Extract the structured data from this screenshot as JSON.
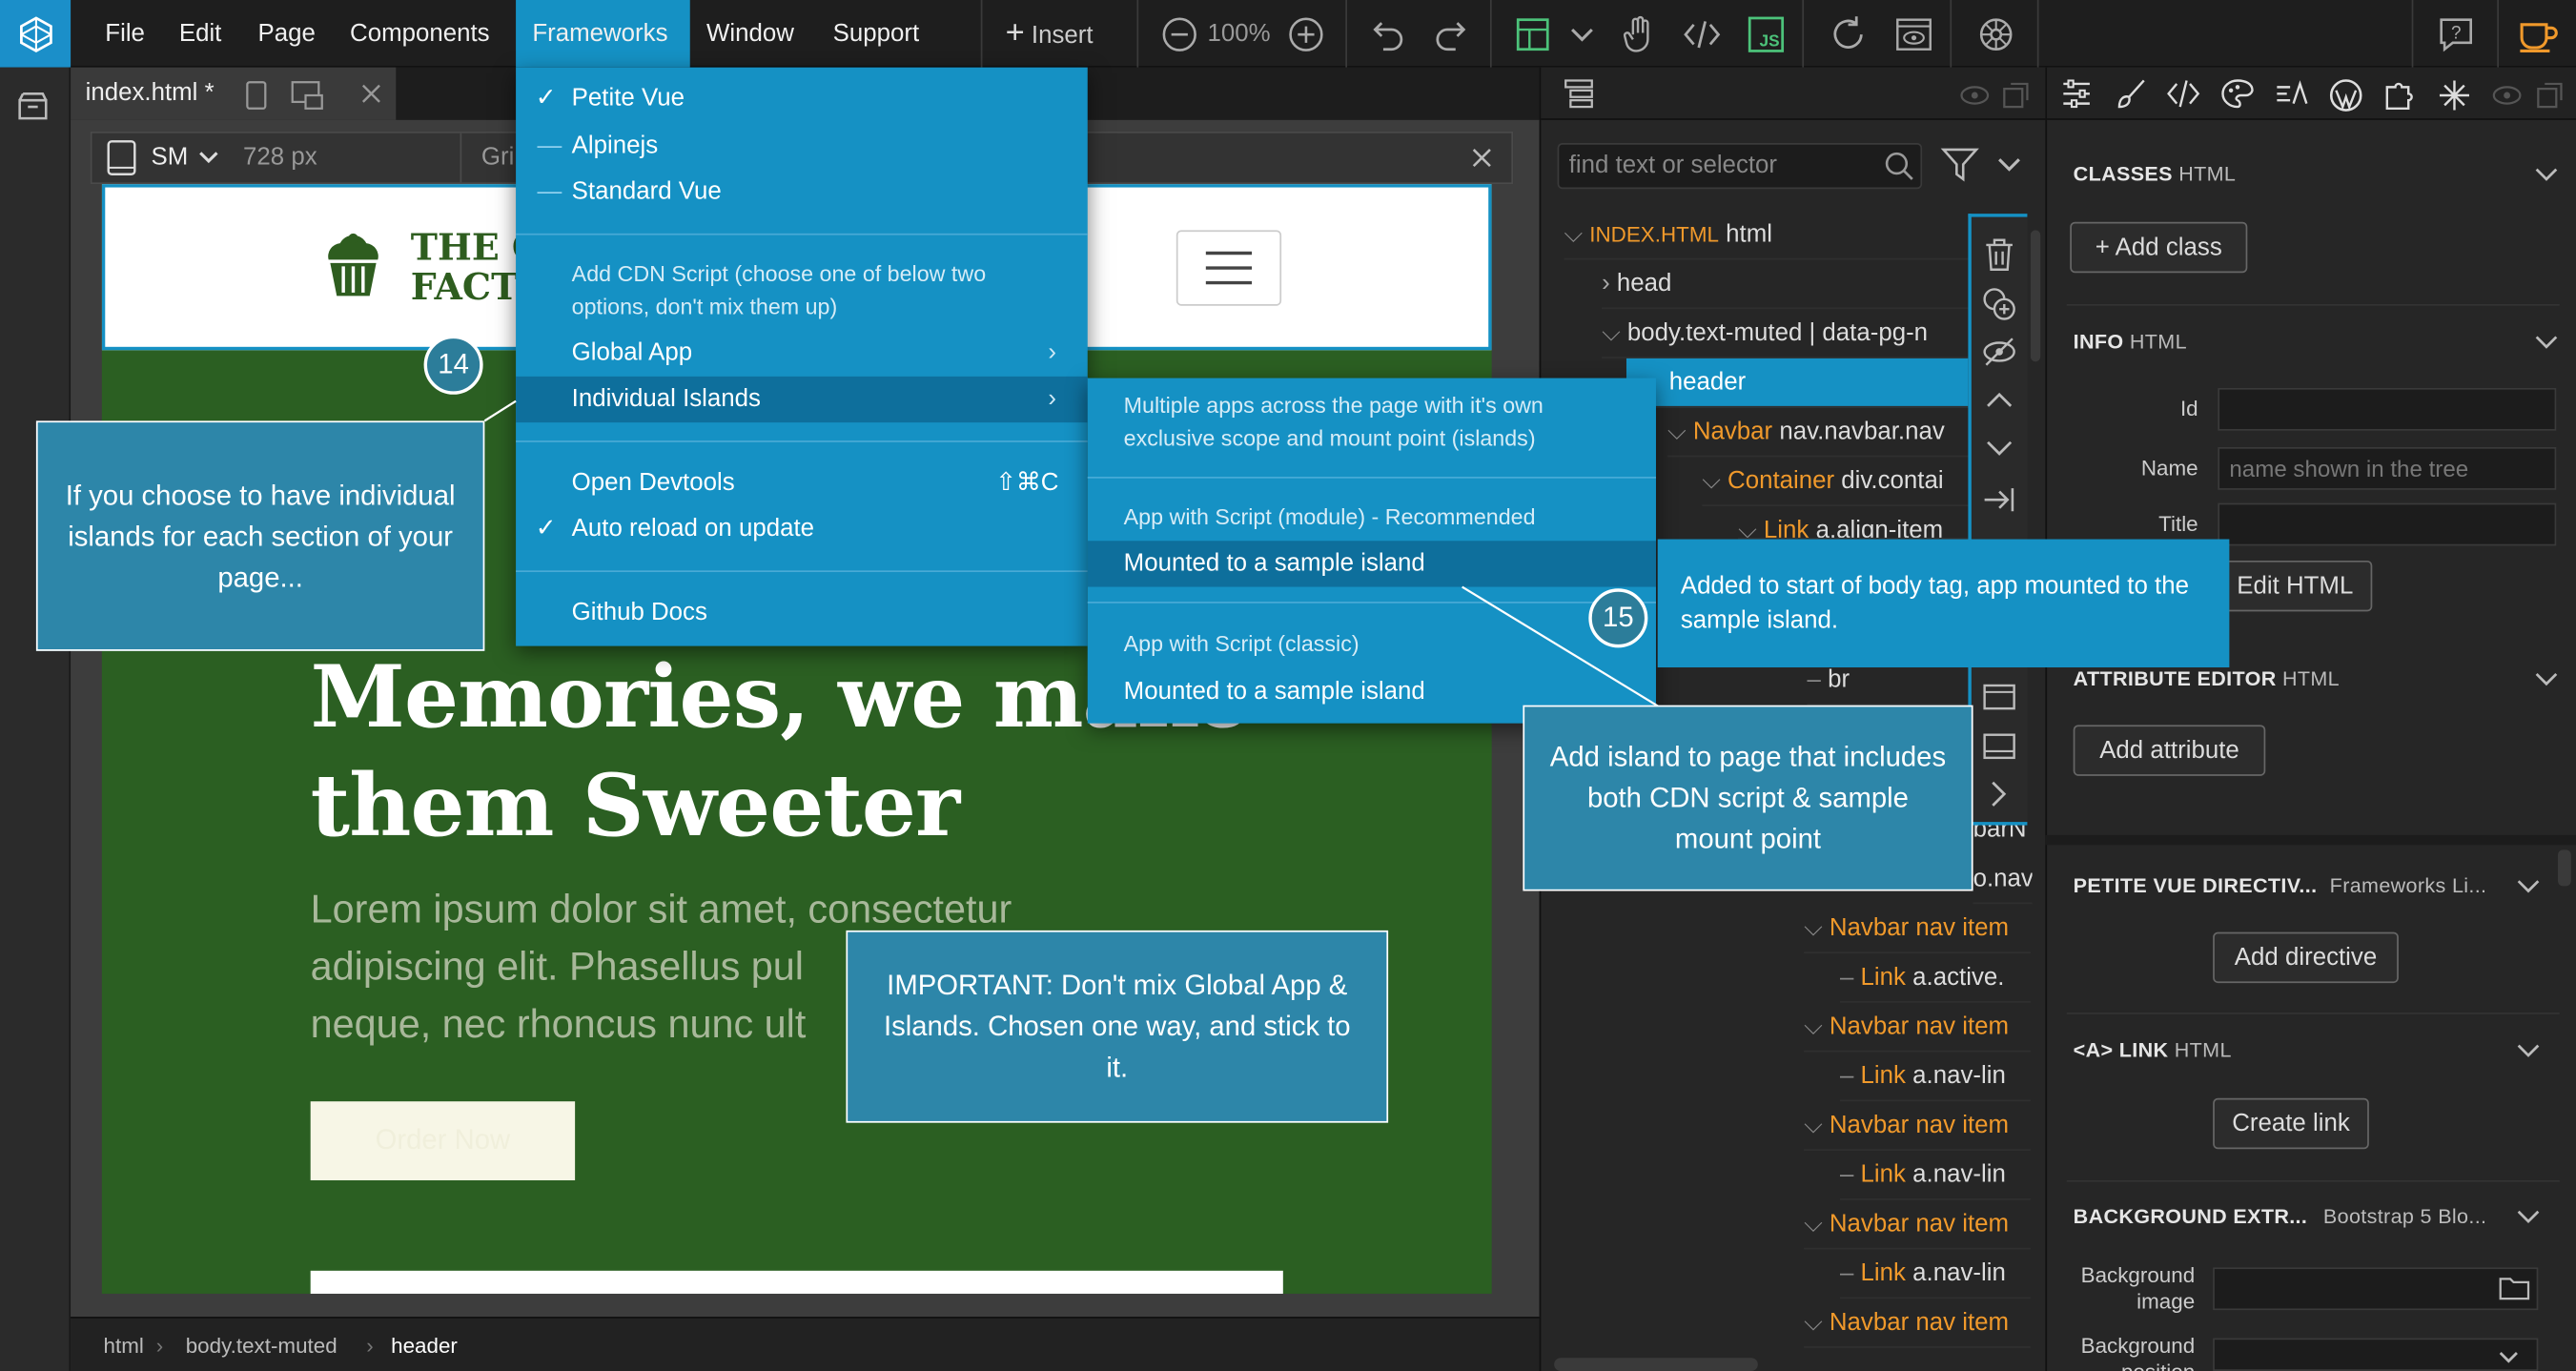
{
  "menubar": {
    "items": [
      "File",
      "Edit",
      "Page",
      "Components",
      "Frameworks",
      "Window",
      "Support"
    ],
    "insert_label": "Insert",
    "zoom": "100%"
  },
  "tab": {
    "filename": "index.html *"
  },
  "device": {
    "size": "SM",
    "width": "728 px",
    "grid_label": "Gri"
  },
  "site": {
    "brand_line1": "THE C",
    "brand_line2": "FACTO",
    "hero_line1": "Memories, we make",
    "hero_line2": "them Sweeter",
    "lorem_line1": "Lorem ipsum dolor sit amet, consectetur",
    "lorem_line2": "adipiscing elit. Phasellus pul",
    "lorem_line3": "neque, nec rhoncus nunc ult",
    "cta": "Order Now"
  },
  "breadcrumbs": [
    "html",
    "body.text-muted",
    "header"
  ],
  "frameworks_menu": {
    "petite_vue": "Petite Vue",
    "alpinejs": "Alpinejs",
    "standard_vue": "Standard Vue",
    "cdn_note": "Add CDN Script (choose one of below two options, don't mix them up)",
    "global_app": "Global App",
    "individual_islands": "Individual Islands",
    "open_devtools": "Open Devtools",
    "devtools_shortcut": "⇧⌘C",
    "auto_reload": "Auto reload on update",
    "github_docs": "Github Docs"
  },
  "islands_submenu": {
    "description": "Multiple apps across the page with it's own exclusive scope and mount point (islands)",
    "module_heading": "App with Script (module) - Recommended",
    "module_item": "Mounted to a sample island",
    "classic_heading": "App with Script (classic)",
    "classic_item": "Mounted to a sample island"
  },
  "callouts": {
    "islands_note": "If you choose to have individual islands for each section of your page...",
    "important_note": "IMPORTANT: Don't mix Global App & Islands. Chosen one way, and stick to it.",
    "body_tag_note": "Added to start of body tag, app mounted to the sample island.",
    "add_island_note": "Add island to page that includes both CDN script & sample mount point",
    "badge_14": "14",
    "badge_15": "15"
  },
  "tree": {
    "search_placeholder": "find text or selector",
    "rows": [
      {
        "tag": "INDEX.HTML",
        "text": "html"
      },
      {
        "tag": "",
        "text": "head"
      },
      {
        "tag": "",
        "text": "body.text-muted | data-pg-n"
      },
      {
        "tag": "",
        "text": "header"
      },
      {
        "tag": "Navbar",
        "text": "nav.navbar.nav"
      },
      {
        "tag": "Container",
        "text": "div.contai"
      },
      {
        "tag": "Link",
        "text": "a.align-item"
      },
      {
        "tag": "",
        "text": "br"
      },
      {
        "tag": "",
        "text": "barN"
      },
      {
        "tag": "",
        "text": "o.nav"
      },
      {
        "tag": "Navbar nav item",
        "text": ""
      },
      {
        "tag": "Link",
        "text": "a.active."
      },
      {
        "tag": "Navbar nav item",
        "text": ""
      },
      {
        "tag": "Link",
        "text": "a.nav-lin"
      },
      {
        "tag": "Navbar nav item",
        "text": ""
      },
      {
        "tag": "Link",
        "text": "a.nav-lin"
      },
      {
        "tag": "Navbar nav item",
        "text": ""
      },
      {
        "tag": "Link",
        "text": "a.nav-lin"
      },
      {
        "tag": "Navbar nav item",
        "text": ""
      }
    ]
  },
  "props": {
    "classes_title": "CLASSES",
    "classes_sub": "HTML",
    "add_class": "Add class",
    "info_title": "INFO",
    "info_sub": "HTML",
    "id_label": "Id",
    "name_label": "Name",
    "name_placeholder": "name shown in the tree",
    "title_label": "Title",
    "edit_html": "Edit HTML",
    "attr_title": "ATTRIBUTE EDITOR",
    "attr_sub": "HTML",
    "add_attribute": "Add attribute",
    "pv_title": "PETITE VUE DIRECTIV...",
    "pv_sub": "Frameworks Li...",
    "add_directive": "Add directive",
    "link_title": "<A> LINK",
    "link_sub": "HTML",
    "create_link": "Create link",
    "bg_title": "BACKGROUND EXTR...",
    "bg_sub": "Bootstrap 5 Blo...",
    "bg_image_label": "Background image",
    "bg_position_label": "Background position"
  },
  "colors": {
    "accent": "#1591c4",
    "callout": "#2d86a9",
    "site_green": "#2b5f22",
    "brand_green": "#2e5d1f",
    "tag_orange": "#f0992b"
  }
}
